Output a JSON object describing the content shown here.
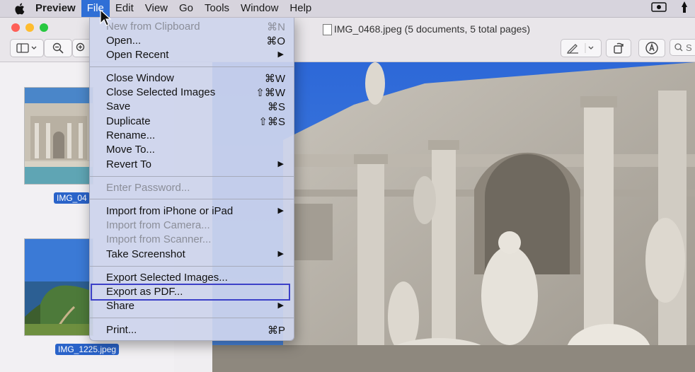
{
  "menubar": {
    "app_name": "Preview",
    "items": [
      "File",
      "Edit",
      "View",
      "Go",
      "Tools",
      "Window",
      "Help"
    ],
    "active_item": "File",
    "right_icons": [
      "screen-record-icon",
      "pen-icon"
    ]
  },
  "window": {
    "title": "IMG_0468.jpeg (5 documents, 5 total pages)",
    "search_placeholder": "S"
  },
  "sidebar": {
    "thumbnails": [
      {
        "label": "IMG_04"
      },
      {
        "label": "IMG_1225.jpeg"
      }
    ]
  },
  "file_menu": {
    "items": [
      {
        "label": "New from Clipboard",
        "shortcut": "⌘N",
        "disabled": true
      },
      {
        "label": "Open...",
        "shortcut": "⌘O"
      },
      {
        "label": "Open Recent",
        "submenu": true
      },
      {
        "label": "Close Window",
        "shortcut": "⌘W"
      },
      {
        "label": "Close Selected Images",
        "shortcut": "⇧⌘W"
      },
      {
        "label": "Save",
        "shortcut": "⌘S"
      },
      {
        "label": "Duplicate",
        "shortcut": "⇧⌘S"
      },
      {
        "label": "Rename..."
      },
      {
        "label": "Move To..."
      },
      {
        "label": "Revert To",
        "submenu": true
      },
      {
        "label": "Enter Password...",
        "disabled": true
      },
      {
        "label": "Import from iPhone or iPad",
        "submenu": true
      },
      {
        "label": "Import from Camera...",
        "disabled": true
      },
      {
        "label": "Import from Scanner...",
        "disabled": true
      },
      {
        "label": "Take Screenshot",
        "submenu": true
      },
      {
        "label": "Export Selected Images..."
      },
      {
        "label": "Export as PDF...",
        "highlighted": true
      },
      {
        "label": "Share",
        "submenu": true
      },
      {
        "label": "Print...",
        "shortcut": "⌘P"
      }
    ]
  },
  "colors": {
    "menu_highlight": "#2f6fd6",
    "annotation_box": "#3c40c8",
    "selection_label": "#2a63c9"
  }
}
